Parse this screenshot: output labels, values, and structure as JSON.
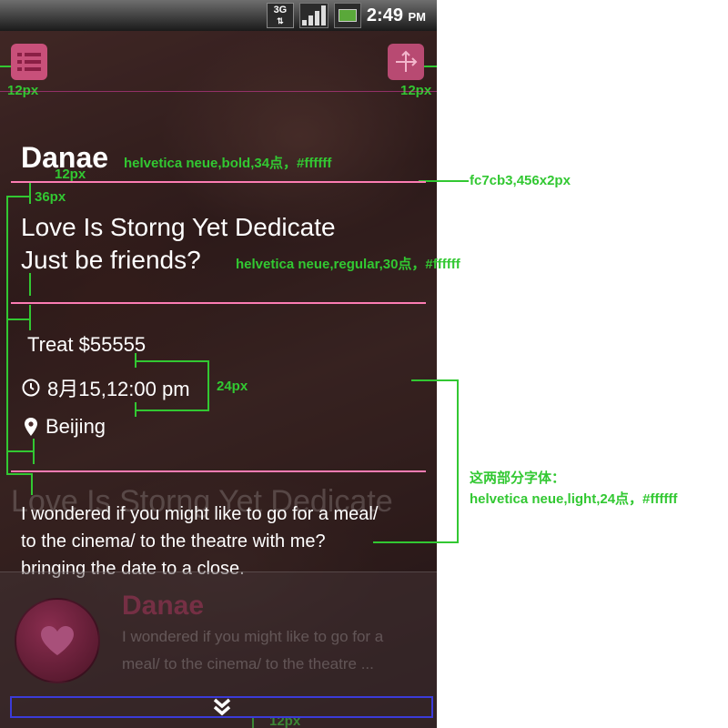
{
  "status": {
    "network": "3G",
    "time": "2:49",
    "ampm": "PM"
  },
  "profile": {
    "name": "Danae",
    "headline_line1": "Love Is Storng Yet Dedicate",
    "headline_line2": "Just be friends?",
    "treat": "Treat $55555",
    "datetime": "8月15,12:00 pm",
    "location": "Beijing",
    "message_line1": "I wondered if you might like to go for a meal/",
    "message_line2": "to the cinema/ to the theatre with me?",
    "message_line3": "bringing the date to a close.",
    "ghost_title": "Love Is Storng Yet Dedicate"
  },
  "next_card": {
    "name": "Danae",
    "preview_line1": "I wondered if you might like to go for a",
    "preview_line2": "meal/ to the  cinema/ to the theatre ..."
  },
  "annotations": {
    "topleft_margin": "12px",
    "topright_margin": "12px",
    "name_font": "helvetica neue,bold,34点，#ffffff",
    "name_gap": "12px",
    "divider_spec": "fc7cb3,456x2px",
    "section_gap": "36px",
    "headline_font": "helvetica neue,regular,30点，#ffffff",
    "row_gap": "24px",
    "light_font_title": "这两部分字体：",
    "light_font_spec": "helvetica neue,light,24点，#ffffff",
    "bottom_margin": "12px"
  },
  "colors": {
    "divider": "#fc7cb3",
    "accent": "#c8507a",
    "annotation": "#32c832",
    "expand_border": "#3b3bd9"
  },
  "icons": [
    "menu-icon",
    "share-icon",
    "clock-icon",
    "location-pin-icon",
    "heart-icon",
    "double-chevron-down-icon"
  ]
}
